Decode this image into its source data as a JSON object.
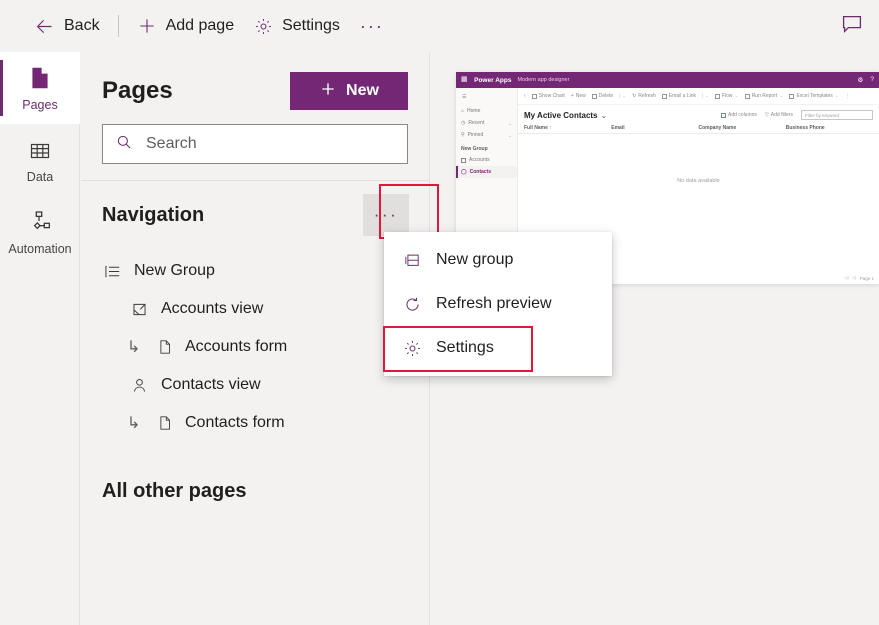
{
  "commandbar": {
    "back_label": "Back",
    "add_page_label": "Add page",
    "settings_label": "Settings",
    "overflow_label": "···",
    "comment_icon": "comment-icon"
  },
  "rail": {
    "items": [
      {
        "label": "Pages",
        "icon": "pages-icon",
        "selected": true
      },
      {
        "label": "Data",
        "icon": "table-icon",
        "selected": false
      },
      {
        "label": "Automation",
        "icon": "flow-icon",
        "selected": false
      }
    ]
  },
  "panel": {
    "title": "Pages",
    "new_button_label": "New",
    "new_button_icon": "plus-icon",
    "search": {
      "placeholder": "Search",
      "value": "",
      "icon": "search-icon"
    },
    "navigation": {
      "title": "Navigation",
      "overflow_label": "···"
    },
    "tree": [
      {
        "label": "New Group",
        "icon": "group-list-icon",
        "level": 0
      },
      {
        "label": "Accounts view",
        "icon": "view-icon",
        "level": 1
      },
      {
        "label": "Accounts form",
        "icon": "form-page-icon",
        "level": 2,
        "arrow": "↳"
      },
      {
        "label": "Contacts view",
        "icon": "contact-person-icon",
        "level": 1
      },
      {
        "label": "Contacts form",
        "icon": "form-page-icon",
        "level": 2,
        "arrow": "↳"
      }
    ],
    "all_other_pages_title": "All other pages"
  },
  "context_menu": {
    "items": [
      {
        "label": "New group",
        "icon": "new-group-icon",
        "highlighted": false
      },
      {
        "label": "Refresh preview",
        "icon": "refresh-icon",
        "highlighted": false
      },
      {
        "label": "Settings",
        "icon": "gear-icon",
        "highlighted": true
      }
    ]
  },
  "preview": {
    "brand": "Power Apps",
    "subtitle": "Modern app designer",
    "topbar_icons": [
      "settings-gear-icon",
      "help-icon"
    ],
    "sidenav": {
      "hamburger": "hamburger-icon",
      "items": [
        {
          "label": "Home",
          "icon": "home-icon",
          "chevron": false,
          "selected": false
        },
        {
          "label": "Recent",
          "icon": "clock-icon",
          "chevron": true,
          "selected": false
        },
        {
          "label": "Pinned",
          "icon": "pin-icon",
          "chevron": true,
          "selected": false
        }
      ],
      "group_label": "New Group",
      "group_items": [
        {
          "label": "Accounts",
          "icon": "accounts-icon",
          "selected": false
        },
        {
          "label": "Contacts",
          "icon": "contacts-icon",
          "selected": true
        }
      ]
    },
    "commandbar": [
      {
        "label": "Show Chart",
        "icon": "chart-icon"
      },
      {
        "label": "New",
        "icon": "plus-icon"
      },
      {
        "label": "Delete",
        "icon": "trash-icon",
        "caret": true
      },
      {
        "label": "Refresh",
        "icon": "refresh-icon"
      },
      {
        "label": "Email a Link",
        "icon": "link-icon",
        "caret": true
      },
      {
        "label": "Flow",
        "icon": "flow-icon",
        "caret": true
      },
      {
        "label": "Run Report",
        "icon": "report-icon",
        "caret": true
      },
      {
        "label": "Excel Templates",
        "icon": "excel-icon",
        "caret": true
      },
      {
        "label": "⋮",
        "icon": "more-vertical-icon"
      }
    ],
    "view_title": "My Active Contacts",
    "view_tools": [
      {
        "label": "Add columns",
        "icon": "add-columns-icon"
      },
      {
        "label": "Add filters",
        "icon": "filter-icon"
      }
    ],
    "filter_placeholder": "Filter by keyword",
    "columns": [
      "Full Name ↑",
      "Email",
      "Company Name",
      "Business Phone"
    ],
    "empty_message": "No data available",
    "pager": {
      "prev": "◁",
      "next": "◁",
      "label": "Page 1"
    }
  },
  "colors": {
    "accent": "#742774",
    "highlight": "#e2173c",
    "panel_bg": "#f3f2f1"
  }
}
